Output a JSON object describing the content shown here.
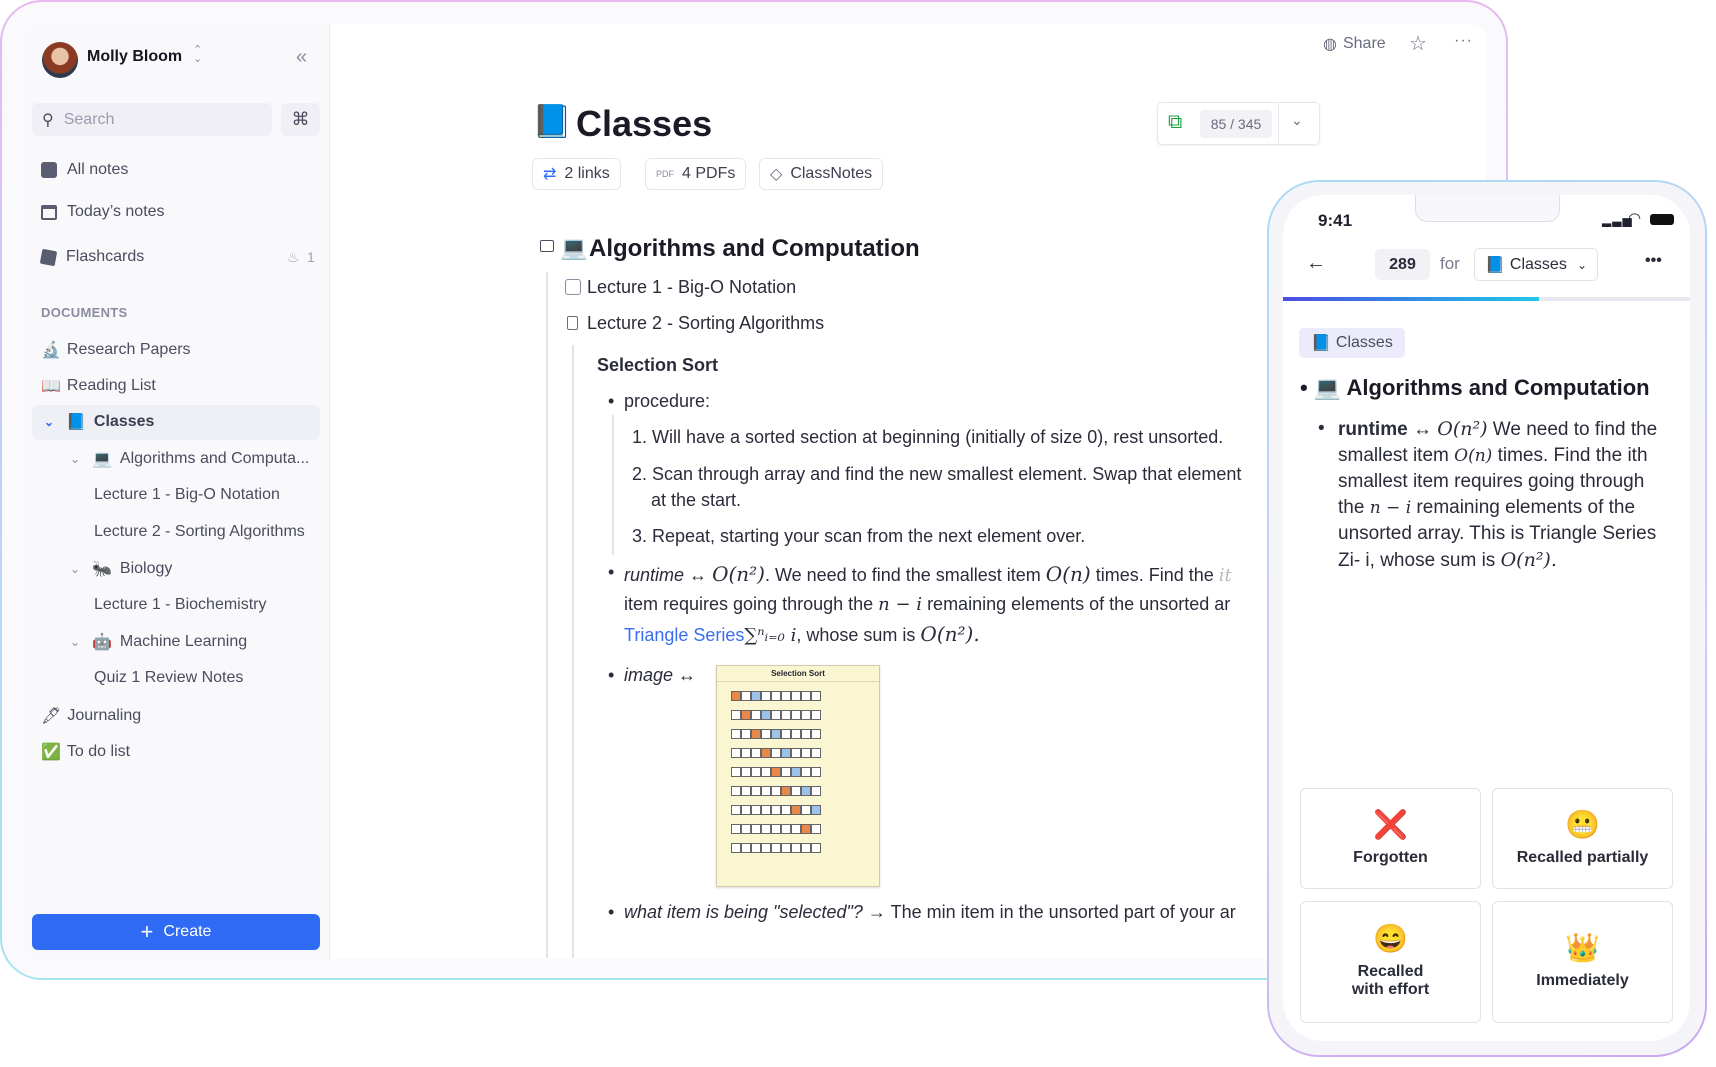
{
  "sidebar": {
    "user_name": "Molly Bloom",
    "search_placeholder": "Search",
    "cmd_key": "⌘",
    "nav": [
      {
        "label": "All notes",
        "icon": "grid-icon"
      },
      {
        "label": "Today’s notes",
        "icon": "calendar-icon"
      },
      {
        "label": "Flashcards",
        "icon": "cards-icon",
        "badge": "1"
      }
    ],
    "section_label": "DOCUMENTS",
    "documents": [
      {
        "emoji": "🔬",
        "label": "Research Papers"
      },
      {
        "emoji": "📖",
        "label": "Reading List"
      },
      {
        "emoji": "📘",
        "label": "Classes"
      },
      {
        "emoji": "💻",
        "label": "Algorithms and Computa..."
      },
      {
        "label": "Lecture 1 - Big-O Notation"
      },
      {
        "label": "Lecture 2 - Sorting Algorithms"
      },
      {
        "emoji": "🐜",
        "label": "Biology"
      },
      {
        "label": "Lecture 1 - Biochemistry"
      },
      {
        "emoji": "🤖",
        "label": "Machine Learning"
      },
      {
        "label": "Quiz 1 Review Notes"
      },
      {
        "emoji": "🖋",
        "label": "Journaling"
      },
      {
        "emoji": "✅",
        "label": "To do list"
      }
    ],
    "create_label": "Create"
  },
  "header": {
    "share_label": "Share"
  },
  "page": {
    "emoji": "📘",
    "title": "Classes",
    "counter": "85 / 345",
    "chips": [
      "2 links",
      "4 PDFs",
      "ClassNotes"
    ],
    "pdf_icon_text": "PDF",
    "section_emoji": "💻",
    "section_title": "Algorithms and Computation",
    "sub_pages": [
      "Lecture 1 - Big-O Notation",
      "Lecture 2 - Sorting Algorithms"
    ],
    "subheading": "Selection Sort",
    "procedure_label": "procedure:",
    "steps": [
      "Will have a sorted section at beginning (initially of size 0), rest unsorted.",
      "Scan through array and find the new smallest element. Swap that element",
      "at the start.",
      "Repeat, starting your scan from the next element over."
    ],
    "runtime_label": "runtime",
    "arrow": "↔",
    "on2": "O(n²)",
    "runtime_text_1": ". We need to find the smallest item",
    "on": "O(n)",
    "runtime_text_2": "times. Find the",
    "runtime_clip": "it",
    "runtime_line2_a": "item requires going through the",
    "n_minus_i": "n − i",
    "runtime_line2_b": "remaining elements of the unsorted ar",
    "triangle_link": "Triangle Series",
    "sum_expr": "∑ⁿᵢ₌₀ i",
    "runtime_line3": ", whose sum is",
    "on2_end": "O(n²).",
    "image_label": "image",
    "image_title": "Selection Sort",
    "question": "what item is being \"selected\"?",
    "question_arrow": "→",
    "answer": "The min item in the unsorted part of your ar"
  },
  "phone": {
    "time": "9:41",
    "count": "289",
    "for_label": "for",
    "deck": "Classes",
    "deck_emoji": "📘",
    "progress": 0.63,
    "tag": "Classes",
    "heading_emoji": "💻",
    "heading": "Algorithms and Computation",
    "runtime_label": "runtime",
    "arrow": "↔",
    "on2": "O(n²)",
    "t1": "We need to find the smallest item",
    "on": "O(n)",
    "t2": "times. Find the ith smallest item requires going through the",
    "n_minus_i": "n − i",
    "t3": "remaining elements of the unsorted array. This is Triangle Series Zi- i, whose sum is",
    "on2_end": "O(n²).",
    "cards": [
      {
        "emoji": "❌",
        "label": "Forgotten"
      },
      {
        "emoji": "😬",
        "label": "Recalled partially"
      },
      {
        "emoji": "😄",
        "label": "Recalled with effort"
      },
      {
        "emoji": "👑",
        "label": "Immediately"
      }
    ]
  },
  "colors": {
    "accent": "#2f6bf5",
    "link": "#3a6df0",
    "progress_start": "#4a4ee0",
    "progress_end": "#1fc8e8"
  }
}
